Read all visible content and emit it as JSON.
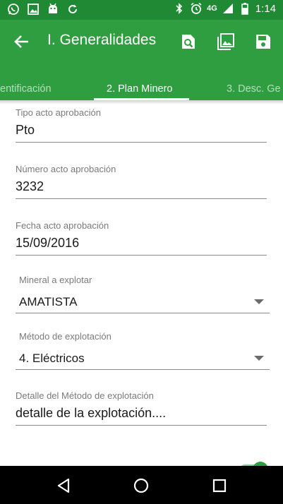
{
  "status_bar": {
    "network": "4G",
    "time": "1:14",
    "left_icons": [
      "whatsapp-icon",
      "image-icon",
      "android-icon",
      "sync-icon"
    ],
    "right_icons": [
      "bluetooth-icon",
      "alarm-icon",
      "signal-icon",
      "battery-icon"
    ]
  },
  "toolbar": {
    "title": "I. Generalidades",
    "actions": [
      "search-document-icon",
      "gallery-icon",
      "save-icon"
    ]
  },
  "tabs": [
    {
      "label": "Identificación",
      "shown": "entificación",
      "active": false
    },
    {
      "label": "2. Plan Minero",
      "shown": "2. Plan Minero",
      "active": true
    },
    {
      "label": "3. Desc. Ge",
      "shown": "3. Desc. Ge",
      "active": false
    }
  ],
  "form": {
    "tipo_acto": {
      "label": "Tipo acto aprobación",
      "value": "Pto"
    },
    "numero_acto": {
      "label": "Número acto aprobación",
      "value": "3232"
    },
    "fecha_acto": {
      "label": "Fecha acto aprobación",
      "value": "15/09/2016"
    },
    "mineral": {
      "label": "Mineral a explotar",
      "value": "AMATISTA"
    },
    "metodo": {
      "label": "Método de explotación",
      "value": "4. Eléctricos"
    },
    "detalle": {
      "label": "Detalle del Método de explotación",
      "value": "detalle de la explotación...."
    }
  },
  "colors": {
    "status_bar": "#1f8a33",
    "primary": "#2e9e40",
    "accent": "#2e9e40"
  }
}
